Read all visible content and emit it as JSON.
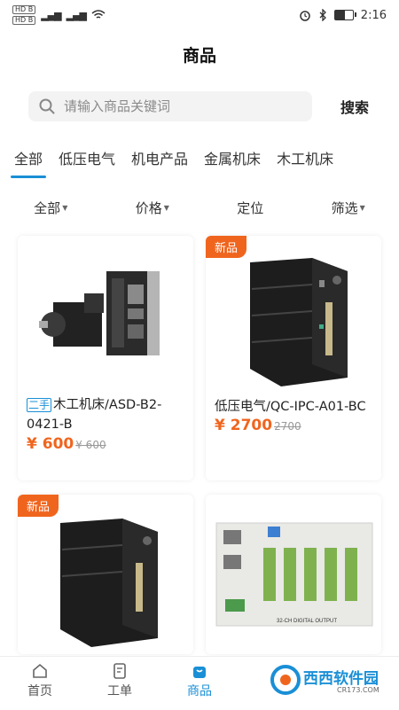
{
  "status": {
    "time": "2:16",
    "left_labels": [
      "HD B",
      "HD B"
    ],
    "signal": "4G",
    "battery_level": 0.55
  },
  "page": {
    "title": "商品"
  },
  "search": {
    "placeholder": "请输入商品关键词",
    "button_label": "搜索"
  },
  "categories": [
    {
      "label": "全部",
      "active": true
    },
    {
      "label": "低压电气"
    },
    {
      "label": "机电产品"
    },
    {
      "label": "金属机床"
    },
    {
      "label": "木工机床"
    }
  ],
  "filters": [
    {
      "label": "全部",
      "has_caret": true
    },
    {
      "label": "价格",
      "has_caret": true
    },
    {
      "label": "定位",
      "has_caret": false
    },
    {
      "label": "筛选",
      "has_caret": true
    }
  ],
  "products": [
    {
      "tag": "二手",
      "title": "木工机床/ASD-B2-0421-B",
      "price": "¥ 600",
      "old_price": "¥ 600",
      "badge": ""
    },
    {
      "tag": "",
      "title": "低压电气/QC-IPC-A01-BC",
      "price": "¥ 2700",
      "old_price": "2700",
      "badge": "新品"
    },
    {
      "tag": "",
      "title": "",
      "price": "",
      "old_price": "",
      "badge": "新品"
    },
    {
      "tag": "",
      "title": "",
      "price": "",
      "old_price": "",
      "badge": "",
      "image_text": "32-CH DIGITAL OUTPUT"
    }
  ],
  "tabbar": [
    {
      "label": "首页",
      "icon": "home-icon"
    },
    {
      "label": "工单",
      "icon": "document-icon"
    },
    {
      "label": "商品",
      "icon": "shopping-bag-icon",
      "active": true
    },
    {
      "label": "",
      "icon": ""
    },
    {
      "label": "",
      "icon": ""
    }
  ],
  "watermark": {
    "text": "西西软件园",
    "sub": "CR173.COM"
  },
  "colors": {
    "accent": "#1a8fd6",
    "price": "#f0651e",
    "badge": "#f0651e"
  }
}
